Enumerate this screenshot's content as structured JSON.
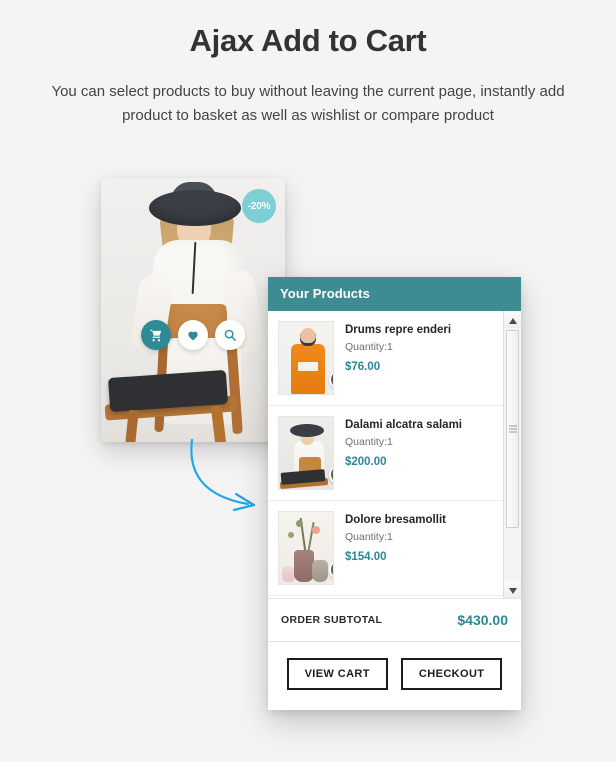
{
  "header": {
    "title": "Ajax Add to Cart",
    "subtitle": "You can select products to buy without leaving the current page, instantly add product to basket as well as wishlist or compare product"
  },
  "product_card": {
    "discount_badge": "-20%",
    "actions": [
      {
        "name": "add-to-cart",
        "icon": "cart-icon",
        "style": "primary"
      },
      {
        "name": "add-to-wishlist",
        "icon": "heart-icon",
        "style": "default"
      },
      {
        "name": "quick-view",
        "icon": "search-icon",
        "style": "default"
      }
    ]
  },
  "cart_panel": {
    "title": "Your Products",
    "items": [
      {
        "name": "Drums repre enderi",
        "quantity_label": "Quantity:1",
        "price": "$76.00",
        "remove_icon": "close-icon"
      },
      {
        "name": "Dalami alcatra salami",
        "quantity_label": "Quantity:1",
        "price": "$200.00",
        "remove_icon": "close-icon"
      },
      {
        "name": "Dolore bresamollit",
        "quantity_label": "Quantity:1",
        "price": "$154.00",
        "remove_icon": "close-icon"
      }
    ],
    "subtotal_label": "ORDER SUBTOTAL",
    "subtotal_value": "$430.00",
    "view_cart_label": "VIEW CART",
    "checkout_label": "CHECKOUT",
    "scrollbar": {
      "up_icon": "caret-up-icon",
      "down_icon": "caret-down-icon"
    }
  },
  "colors": {
    "background": "#f5f4f4",
    "teal": "#3d8b93",
    "teal_price": "#2b8793",
    "badge_teal": "#7ccfd2",
    "arrow_blue": "#1ca8ea",
    "title_dark": "#333333"
  },
  "annotations": {
    "arrow_icon": "curved-arrow-icon"
  }
}
